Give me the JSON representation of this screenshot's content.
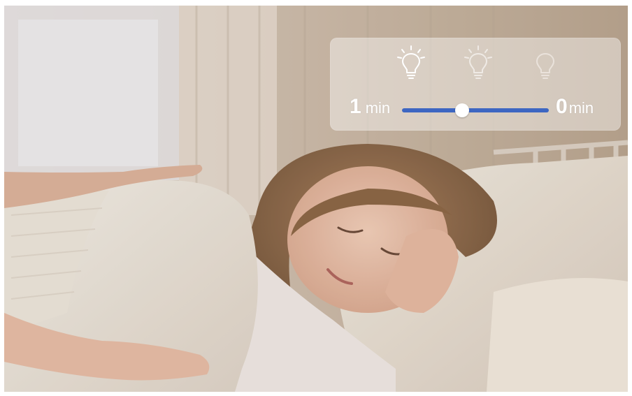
{
  "dimmer": {
    "start_value": "1",
    "start_unit": "min",
    "end_value": "0",
    "end_unit": "min",
    "slider_position": 0.41,
    "accent_color": "#3d66c2",
    "bulbs": [
      {
        "icon": "bulb-bright-icon",
        "state": "bright"
      },
      {
        "icon": "bulb-dim-icon",
        "state": "dim"
      },
      {
        "icon": "bulb-off-icon",
        "state": "off"
      }
    ]
  },
  "photo": {
    "subject": "child-sleeping-in-bed"
  }
}
